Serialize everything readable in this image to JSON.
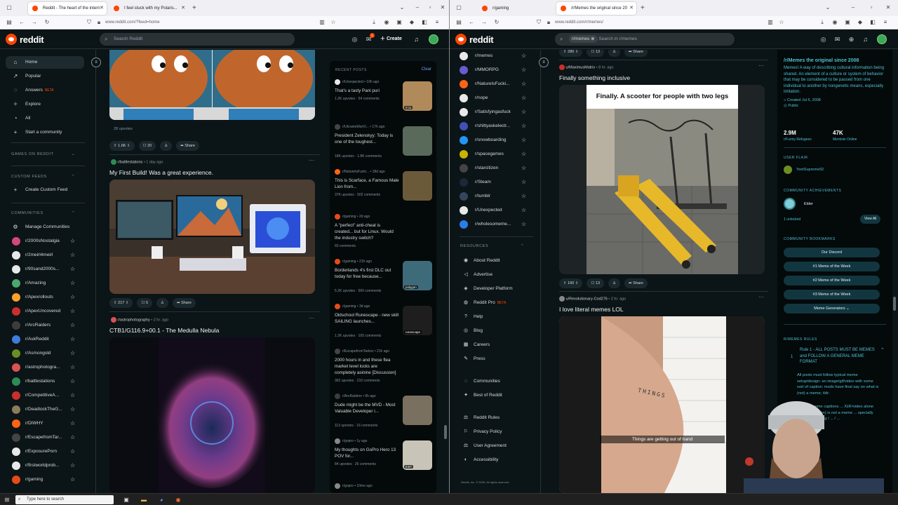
{
  "left": {
    "tabs": [
      {
        "label": "Reddit - The heart of the intern",
        "active": true
      },
      {
        "label": "I feel stuck with my Polaris...",
        "active": false
      }
    ],
    "url": "www.reddit.com/?feed=home",
    "search_placeholder": "Search Reddit",
    "create_label": "Create",
    "notif_count": "1",
    "nav": [
      {
        "label": "Home",
        "icon": "home-icon"
      },
      {
        "label": "Popular",
        "icon": "popular-icon"
      },
      {
        "label": "Answers",
        "icon": "answers-icon",
        "badge": "BETA"
      },
      {
        "label": "Explore",
        "icon": "explore-icon"
      },
      {
        "label": "All",
        "icon": "all-icon"
      },
      {
        "label": "Start a community",
        "icon": "plus-icon"
      }
    ],
    "sections": {
      "games": "GAMES ON REDDIT",
      "custom": "CUSTOM FEEDS",
      "create_custom": "Create Custom Feed",
      "communities": "COMMUNITIES",
      "manage": "Manage Communities"
    },
    "communities": [
      {
        "name": "r/2000sNostalgia",
        "color": "#d4477a"
      },
      {
        "name": "r/2meirl4meirl",
        "color": "#e8e8e8"
      },
      {
        "name": "r/90sand2000s...",
        "color": "#e8e8e8"
      },
      {
        "name": "r/Amazing",
        "color": "#4aa86b"
      },
      {
        "name": "r/Apexrollouts",
        "color": "#ff9f2e"
      },
      {
        "name": "r/ApexUncovered",
        "color": "#c9302c"
      },
      {
        "name": "r/ArcRaiders",
        "color": "#3c3c3c"
      },
      {
        "name": "r/AskReddit",
        "color": "#3f7ddb"
      },
      {
        "name": "r/Asmongold",
        "color": "#6b8e23"
      },
      {
        "name": "r/astrophotogra...",
        "color": "#d9534f"
      },
      {
        "name": "r/battlestations",
        "color": "#2e8b57"
      },
      {
        "name": "r/CompetitiveA...",
        "color": "#c9302c"
      },
      {
        "name": "r/DeadlockTheG...",
        "color": "#8b7d5a"
      },
      {
        "name": "r/DIWHY",
        "color": "#ff6314"
      },
      {
        "name": "r/EscapefromTar...",
        "color": "#444444"
      },
      {
        "name": "r/ExposurePorn",
        "color": "#e8e8e8"
      },
      {
        "name": "r/firstworldprob...",
        "color": "#e8e8e8"
      },
      {
        "name": "r/gaming",
        "color": "#e64a19"
      }
    ],
    "feed": {
      "post0": {
        "upvotes_line": "28 upvotes",
        "score": "1.6K",
        "comments": "20",
        "share": "Share"
      },
      "post1": {
        "sub": "r/battlestations",
        "time": "• 1 day ago",
        "title": "My First Build! Was a great experience.",
        "score": "217",
        "comments": "5",
        "share": "Share"
      },
      "post2": {
        "sub": "r/astrophotography",
        "time": "• 2 hr. ago",
        "title": "CTB1/G116.9+00.1 - The Medulla Nebula"
      }
    },
    "recent": {
      "header": "RECENT POSTS",
      "clear": "Clear",
      "items": [
        {
          "sub": "r/Unexpected",
          "time": "• 19h ago",
          "title": "That's a tasty Pani puri",
          "stats": "1.2K upvotes · 54 comments",
          "thumb": "#b08a5a",
          "dur": "0:11"
        },
        {
          "sub": "r/UkraineWarVi...",
          "time": "• 17h ago",
          "title": "President Zelenskyy: Today is one of the toughest...",
          "stats": "18K upvotes · 1.8K comments",
          "thumb": "#5a6a5a"
        },
        {
          "sub": "r/NatureIsFucki...",
          "time": "• 18d ago",
          "title": "This is Scarface, a Famous Male Lion from...",
          "stats": "37K upvotes · 502 comments",
          "thumb": "#6b5a3a"
        },
        {
          "sub": "r/gaming",
          "time": "• 2d ago",
          "title": "A \"perfect\" anti-cheat is created... but for Linux. Would the industry switch?",
          "stats": "60 comments",
          "thumb": ""
        },
        {
          "sub": "r/gaming",
          "time": "• 21h ago",
          "title": "Borderlands 4's first DLC out today for free because...",
          "stats": "5.2K upvotes · 560 comments",
          "thumb": "#3d6b7a",
          "dur": "polygon"
        },
        {
          "sub": "r/gaming",
          "time": "• 3d ago",
          "title": "Oldschool Runescape - new skill SAILING launches...",
          "stats": "1.2K upvotes · 105 comments",
          "thumb": "#1e1e1e",
          "dur": "runescape"
        },
        {
          "sub": "r/EscapefromTarkov",
          "time": "• 21h ago",
          "title": "2000 hours in and these flea market level locks are completely asinine [Discussion]",
          "stats": "362 upvotes · 210 comments",
          "thumb": ""
        },
        {
          "sub": "r/ArcRaiders",
          "time": "• 6h ago",
          "title": "Dude might be the MVD - Most Valuable Developer i...",
          "stats": "113 upvotes · 16 comments",
          "thumb": "#7a7060"
        },
        {
          "sub": "r/gopro",
          "time": "• 1y ago",
          "title": "My thoughts on GoPro Hero 13 POV for...",
          "stats": "84 upvotes · 26 comments",
          "thumb": "#c9c4b8",
          "dur": "0:57"
        },
        {
          "sub": "r/gopro",
          "time": "• 10mo ago",
          "title": "",
          "stats": "",
          "thumb": ""
        }
      ]
    }
  },
  "right": {
    "tabs": [
      {
        "label": "r/gaming",
        "active": false
      },
      {
        "label": "/r/Memes the original since 20",
        "active": true
      }
    ],
    "url": "www.reddit.com/r/memes/",
    "search_chip": "r/memes",
    "search_placeholder": "Search in r/memes",
    "communities": [
      {
        "name": "r/memes",
        "color": "#e8e8e8"
      },
      {
        "name": "r/MMORPG",
        "color": "#6a5acd"
      },
      {
        "name": "r/NatureIsFucki...",
        "color": "#ff6314"
      },
      {
        "name": "r/nope",
        "color": "#e8e8e8"
      },
      {
        "name": "r/Satisfyingasfuck",
        "color": "#e8e8e8"
      },
      {
        "name": "r/shittyaskelectr...",
        "color": "#3f51b5"
      },
      {
        "name": "r/snowboarding",
        "color": "#2196f3"
      },
      {
        "name": "r/spacegames",
        "color": "#c8b400"
      },
      {
        "name": "r/starcitizen",
        "color": "#444444"
      },
      {
        "name": "r/Steam",
        "color": "#1b2838"
      },
      {
        "name": "r/tumblr",
        "color": "#35465c"
      },
      {
        "name": "r/Unexpected",
        "color": "#e8e8e8"
      },
      {
        "name": "r/wholesomeme...",
        "color": "#2b7de9"
      }
    ],
    "resources_header": "RESOURCES",
    "resources": [
      {
        "label": "About Reddit",
        "icon": "reddit-icon"
      },
      {
        "label": "Advertise",
        "icon": "megaphone-icon"
      },
      {
        "label": "Developer Platform",
        "icon": "dev-icon"
      },
      {
        "label": "Reddit Pro",
        "icon": "pro-icon",
        "badge": "BETA"
      },
      {
        "label": "Help",
        "icon": "help-icon"
      },
      {
        "label": "Blog",
        "icon": "blog-icon"
      },
      {
        "label": "Careers",
        "icon": "careers-icon"
      },
      {
        "label": "Press",
        "icon": "press-icon"
      },
      {
        "label": "Communities",
        "icon": "communities-icon"
      },
      {
        "label": "Best of Reddit",
        "icon": "best-icon"
      },
      {
        "label": "Reddit Rules",
        "icon": "rules-icon"
      },
      {
        "label": "Privacy Policy",
        "icon": "privacy-icon"
      },
      {
        "label": "User Agreement",
        "icon": "agreement-icon"
      },
      {
        "label": "Accessibility",
        "icon": "access-icon"
      }
    ],
    "copyright": "Reddit, Inc. © 2025. All rights reserved.",
    "feed": {
      "top_stats": {
        "score": "280",
        "comments": "13",
        "share": "Share"
      },
      "post1": {
        "user": "u/MaximusMatrix",
        "time": "• 8 hr. ago",
        "title": "Finally something inclusive",
        "caption": "Finally. A scooter for people with two legs",
        "score": "160",
        "comments": "13",
        "share": "Share"
      },
      "post2": {
        "user": "u/Revolutionary-Cod276",
        "time": "• 2 hr. ago",
        "title": "I love literal memes LOL",
        "subtitle": "Things are getting out of hand",
        "tattoo": "THINGS"
      }
    },
    "about": {
      "title": "/r/Memes the original since 2008",
      "desc": "Memes! A way of describing cultural information being shared. An element of a culture or system of behavior that may be considered to be passed from one individual to another by nongenetic means, especially imitation.",
      "created": "Created Jul 5, 2008",
      "visibility": "Public",
      "members": "2.9M",
      "members_label": "r/Funny Refugees",
      "online": "47K",
      "online_label": "Memists Online",
      "user_flair_h": "USER FLAIR",
      "user": "YeetSupreme92",
      "achievements_h": "COMMUNITY ACHIEVEMENTS",
      "achievement": "Elder",
      "unlocked": "1 unlocked",
      "view_all": "View All",
      "bookmarks_h": "COMMUNITY BOOKMARKS",
      "bookmarks": [
        "Our Discord",
        "#1 Meme of the Week",
        "#2 Meme of the Week",
        "#3 Meme of the Week",
        "Meme Generators"
      ],
      "rules_h": "R/MEMES RULES",
      "rule1_num": "1",
      "rule1_title": "Rule 1 - ALL POSTS MUST BE MEMES and FOLLOW A GENERAL MEME FORMAT",
      "rule1_body": "All posts must follow typical meme setup/design: an image/gif/video with some sort of caption: mods have final say on what is (not) a meme; tldr:",
      "rule1_more": "titles as meme captions ... /GIF/video alone (without caption) is not a meme ... specially screen recording / ... / ..."
    }
  },
  "taskbar": {
    "search": "Type here to search"
  }
}
